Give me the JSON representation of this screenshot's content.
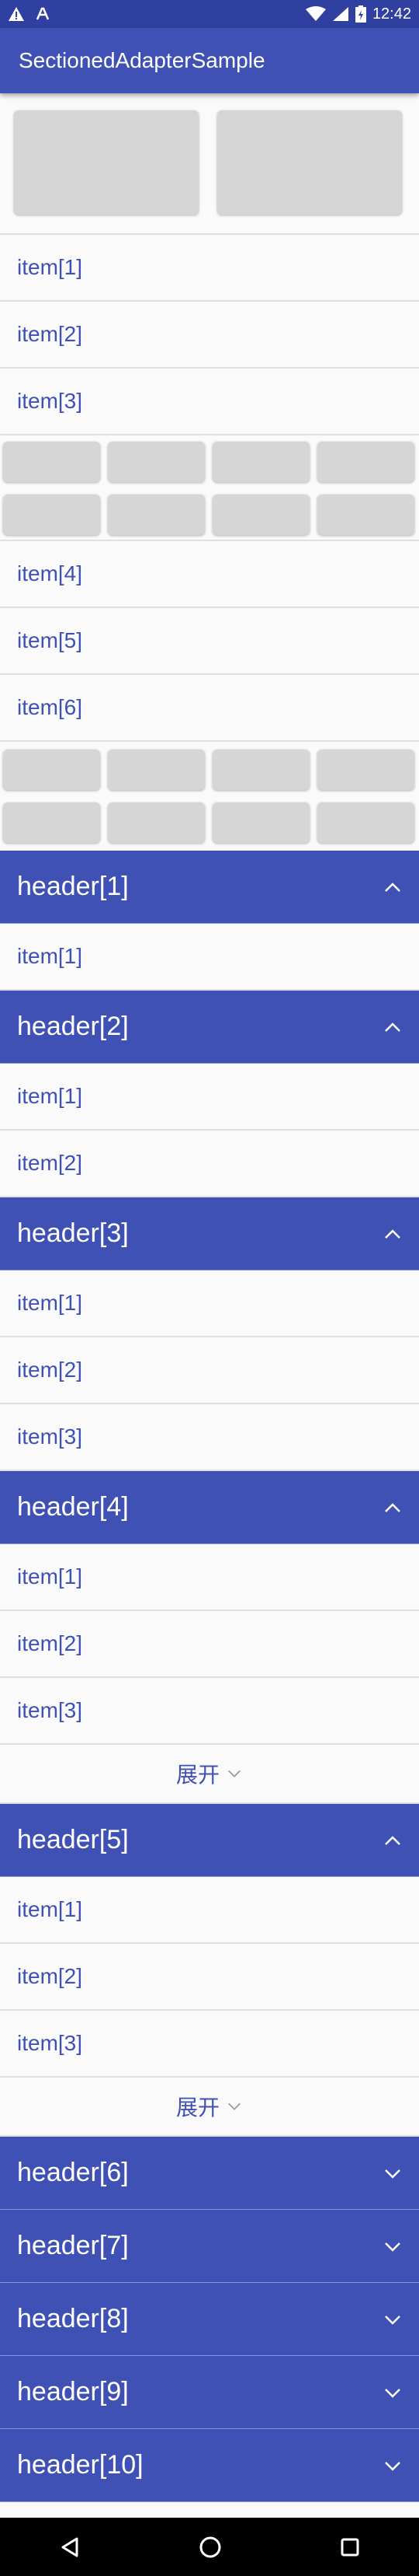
{
  "status_bar": {
    "time": "12:42",
    "icons": [
      "warning-icon",
      "notification-icon",
      "wifi-icon",
      "signal-icon",
      "battery-icon"
    ]
  },
  "app_bar": {
    "title": "SectionedAdapterSample"
  },
  "top_items": [
    "item[1]",
    "item[2]",
    "item[3]"
  ],
  "middle_items": [
    "item[4]",
    "item[5]",
    "item[6]"
  ],
  "sections": [
    {
      "header": "header[1]",
      "expanded": true,
      "items": [
        "item[1]"
      ]
    },
    {
      "header": "header[2]",
      "expanded": true,
      "items": [
        "item[1]",
        "item[2]"
      ]
    },
    {
      "header": "header[3]",
      "expanded": true,
      "items": [
        "item[1]",
        "item[2]",
        "item[3]"
      ]
    },
    {
      "header": "header[4]",
      "expanded": true,
      "items": [
        "item[1]",
        "item[2]",
        "item[3]"
      ],
      "footer": "展开"
    },
    {
      "header": "header[5]",
      "expanded": true,
      "items": [
        "item[1]",
        "item[2]",
        "item[3]"
      ],
      "footer": "展开"
    },
    {
      "header": "header[6]",
      "expanded": false,
      "items": []
    },
    {
      "header": "header[7]",
      "expanded": false,
      "items": []
    },
    {
      "header": "header[8]",
      "expanded": false,
      "items": []
    },
    {
      "header": "header[9]",
      "expanded": false,
      "items": []
    },
    {
      "header": "header[10]",
      "expanded": false,
      "items": []
    }
  ],
  "nav_bar": {
    "icons": [
      "back-icon",
      "home-icon",
      "recents-icon"
    ]
  }
}
